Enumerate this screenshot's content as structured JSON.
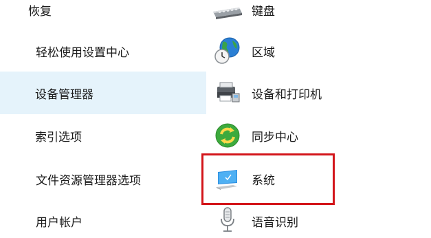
{
  "left_items": [
    {
      "label": "恢复"
    },
    {
      "label": "轻松使用设置中心"
    },
    {
      "label": "设备管理器"
    },
    {
      "label": "索引选项"
    },
    {
      "label": "文件资源管理器选项"
    },
    {
      "label": "用户帐户"
    }
  ],
  "right_items": [
    {
      "label": "键盘",
      "icon": "keyboard-icon"
    },
    {
      "label": "区域",
      "icon": "globe-clock-icon"
    },
    {
      "label": "设备和打印机",
      "icon": "printer-icon"
    },
    {
      "label": "同步中心",
      "icon": "sync-icon"
    },
    {
      "label": "系统",
      "icon": "computer-icon"
    },
    {
      "label": "语音识别",
      "icon": "microphone-icon"
    }
  ],
  "colors": {
    "hover_background": "#e5f3fb",
    "highlight_border": "#d3151a"
  }
}
